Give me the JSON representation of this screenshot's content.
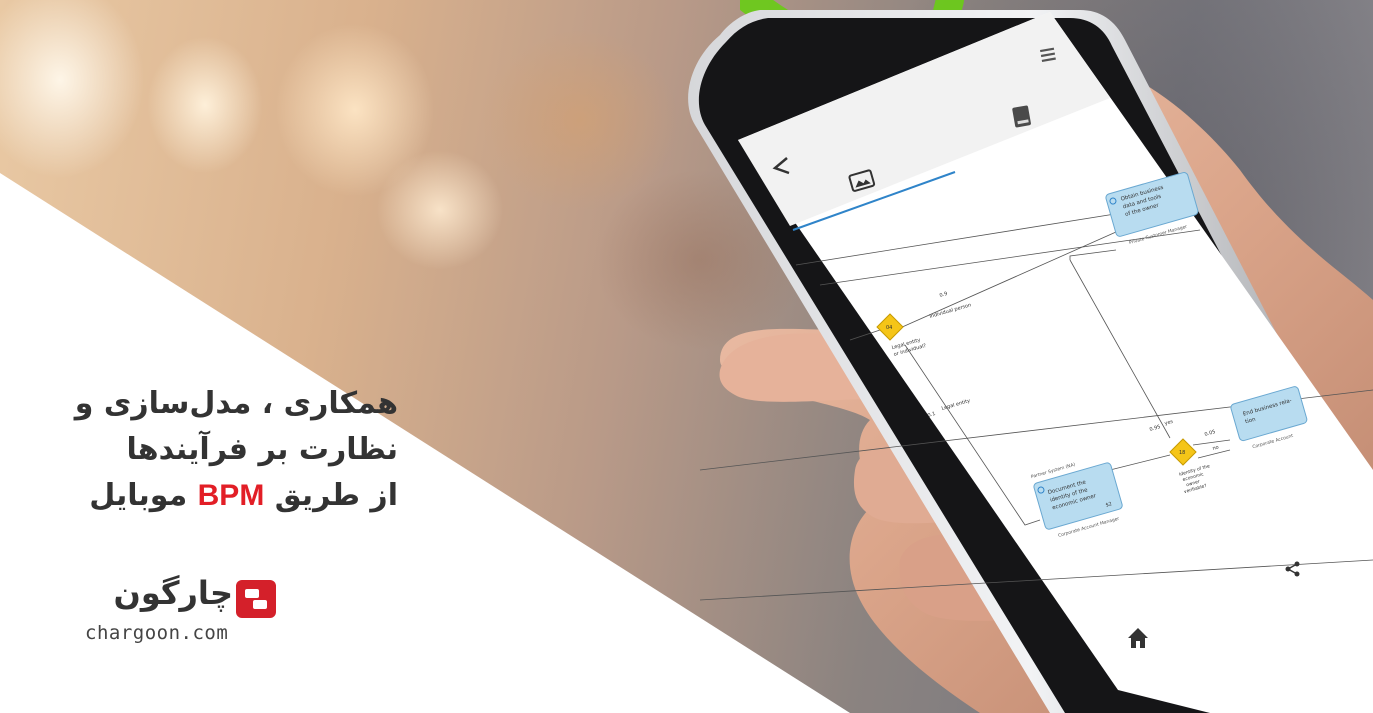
{
  "headline": {
    "line1": "همکاری ، مدل‌سازی و",
    "line2": "نظارت بر فرآیندها",
    "line3_prefix": "از طریق",
    "line3_accent": "BPM",
    "line3_suffix": "موبایل"
  },
  "logo": {
    "name": "چارگون",
    "url": "chargoon.com"
  },
  "colors": {
    "accent_red": "#e21e26",
    "logo_red": "#d4202a",
    "watermark_green": "#6cc91a",
    "task_blue": "#b8dcf0",
    "gateway_yellow": "#f5c518"
  },
  "phone": {
    "icons": [
      "menu-icon",
      "book-icon",
      "back-icon",
      "image-icon",
      "share-icon",
      "home-icon"
    ],
    "diagram": {
      "tasks": [
        {
          "text": "Obtain business data and tools of the owner",
          "lane": "Private Customer Manager"
        },
        {
          "text": "Document the identity of the economic owner",
          "lane": "Corporate Account Manager",
          "pool": "Partner System (NA)",
          "badge": "$2"
        },
        {
          "text": "End business relation",
          "lane": "Corporate Account"
        }
      ],
      "gateways": [
        {
          "number": "04",
          "label": "Legal entity or individual?"
        },
        {
          "number": "18",
          "label": "Identity of the economic owner verifiable?"
        }
      ],
      "flows": [
        {
          "prob": "0.9",
          "label": "Individual person"
        },
        {
          "prob": "0.1",
          "label": "Legal entity"
        },
        {
          "prob": "0.95",
          "label": "yes"
        },
        {
          "prob": "0.05",
          "label": "no"
        }
      ]
    }
  }
}
